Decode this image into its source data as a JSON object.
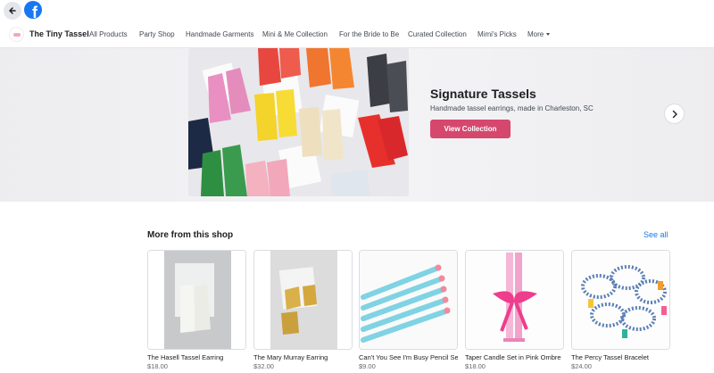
{
  "topbar": {
    "back_icon": "arrow-left-icon",
    "logo_letter": "f",
    "logo_icon": "facebook-logo-icon",
    "logo_color": "#1877f2"
  },
  "shop": {
    "name": "The Tiny Tassel",
    "nav": [
      "All Products",
      "Party Shop",
      "Handmade Garments",
      "Mini & Me Collection",
      "For the Bride to Be",
      "Curated Collection",
      "Mimi's Picks"
    ],
    "more_label": "More"
  },
  "hero": {
    "title": "Signature Tassels",
    "subtitle": "Handmade tassel earrings, made in Charleston, SC",
    "button": "View Collection",
    "button_color": "#d6476e",
    "next_icon": "chevron-right-icon"
  },
  "more_section": {
    "title": "More from this shop",
    "see_all": "See all",
    "products": [
      {
        "name": "The Hasell Tassel Earring",
        "price": "$18.00"
      },
      {
        "name": "The Mary Murray Earring",
        "price": "$32.00"
      },
      {
        "name": "Can't You See I'm Busy Pencil Set",
        "price": "$9.00"
      },
      {
        "name": "Taper Candle Set in Pink Ombre",
        "price": "$18.00"
      },
      {
        "name": "The Percy Tassel Bracelet",
        "price": "$24.00"
      }
    ]
  }
}
